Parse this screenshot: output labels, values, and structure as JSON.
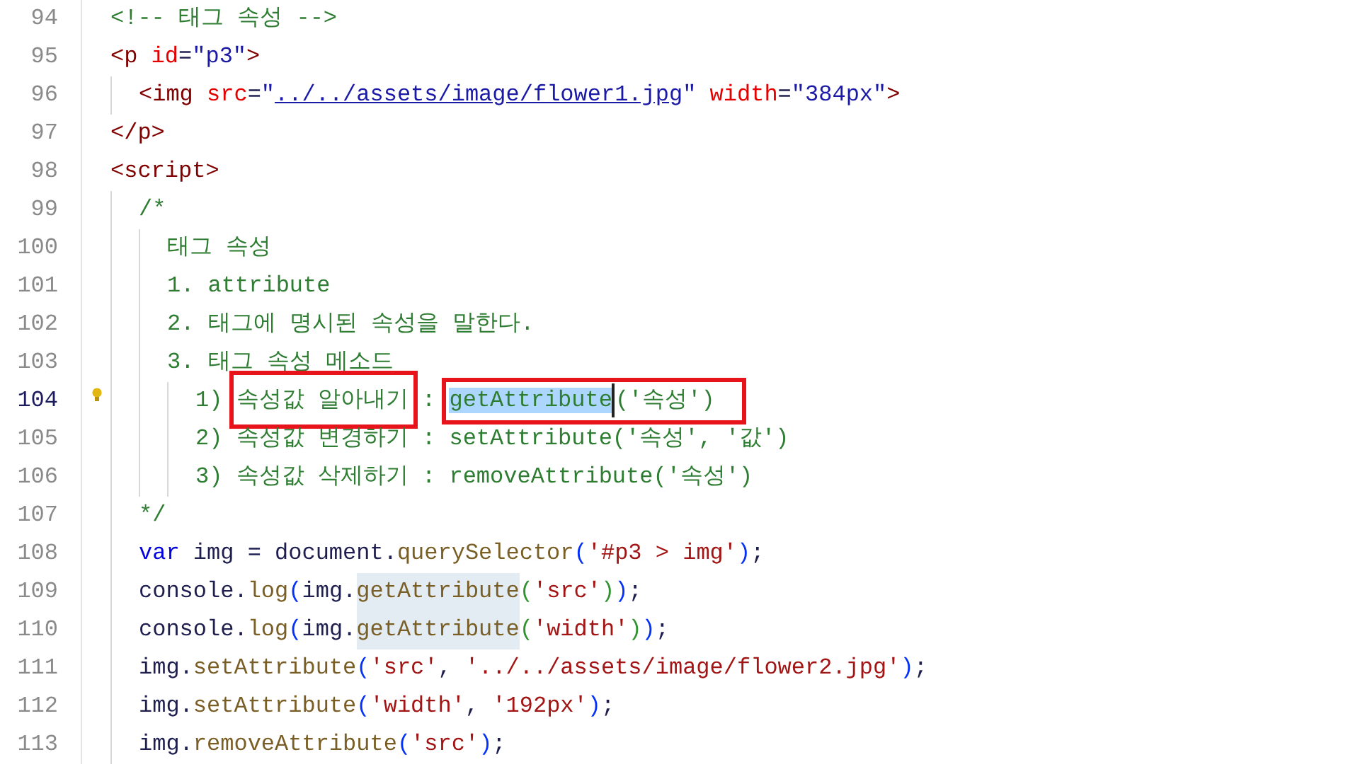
{
  "editor": {
    "lines": [
      {
        "number": "94",
        "tokens": [
          {
            "kind": "comment",
            "text": "<!-- 태그 속성 -->"
          }
        ]
      },
      {
        "number": "95",
        "tokens": [
          {
            "kind": "tag",
            "text": "<p"
          },
          {
            "kind": "attr",
            "text": " id"
          },
          {
            "kind": "plain",
            "text": "="
          },
          {
            "kind": "value",
            "text": "\"p3\""
          },
          {
            "kind": "tag",
            "text": ">"
          }
        ],
        "children": [
          {
            "number": "96",
            "tokens": [
              {
                "kind": "tag",
                "text": "<img"
              },
              {
                "kind": "attr",
                "text": " src"
              },
              {
                "kind": "plain",
                "text": "="
              },
              {
                "kind": "value",
                "text": "\""
              },
              {
                "kind": "link",
                "text": "../../assets/image/flower1.jpg"
              },
              {
                "kind": "value",
                "text": "\""
              },
              {
                "kind": "attr",
                "text": " width"
              },
              {
                "kind": "plain",
                "text": "="
              },
              {
                "kind": "value",
                "text": "\"384px\""
              },
              {
                "kind": "tag",
                "text": ">"
              }
            ]
          }
        ]
      },
      {
        "number": "97",
        "tokens": [
          {
            "kind": "tag",
            "text": "</p>"
          }
        ]
      },
      {
        "number": "98",
        "tokens": [
          {
            "kind": "tag",
            "text": "<script>"
          }
        ],
        "children": [
          {
            "number": "99",
            "tokens": [
              {
                "kind": "comment",
                "text": "/*"
              }
            ],
            "children": [
              {
                "number": "100",
                "tokens": [
                  {
                    "kind": "comment",
                    "text": "태그 속성"
                  }
                ]
              },
              {
                "number": "101",
                "tokens": [
                  {
                    "kind": "comment",
                    "text": "1. attribute"
                  }
                ]
              },
              {
                "number": "102",
                "tokens": [
                  {
                    "kind": "comment",
                    "text": "2. 태그에 명시된 속성을 말한다."
                  }
                ]
              },
              {
                "number": "103",
                "tokens": [
                  {
                    "kind": "comment",
                    "text": "3. 태그 속성 메소드"
                  }
                ],
                "children": [
                  {
                    "number": "104",
                    "current": true,
                    "lightbulb": true,
                    "tokens": [
                      {
                        "kind": "comment",
                        "text": "1) "
                      },
                      {
                        "kind": "box",
                        "tokens": [
                          {
                            "kind": "comment",
                            "text": "속성값 알아내기"
                          }
                        ]
                      },
                      {
                        "kind": "comment",
                        "text": " : "
                      },
                      {
                        "kind": "box",
                        "tokens": [
                          {
                            "kind": "comment",
                            "text": "getAttribute",
                            "selected": true
                          },
                          {
                            "kind": "cursor"
                          },
                          {
                            "kind": "comment",
                            "text": "('속성')"
                          }
                        ]
                      }
                    ]
                  },
                  {
                    "number": "105",
                    "tokens": [
                      {
                        "kind": "comment",
                        "text": "2) 속성값 변경하기 : setAttribute('속성', '값')"
                      }
                    ]
                  },
                  {
                    "number": "106",
                    "tokens": [
                      {
                        "kind": "comment",
                        "text": "3) 속성값 삭제하기 : removeAttribute('속성')"
                      }
                    ]
                  }
                ]
              }
            ]
          },
          {
            "number": "107",
            "tokens": [
              {
                "kind": "comment",
                "text": "*/"
              }
            ]
          },
          {
            "number": "108",
            "tokens": [
              {
                "kind": "keyword",
                "text": "var"
              },
              {
                "kind": "plain",
                "text": " img = document."
              },
              {
                "kind": "method",
                "text": "querySelector"
              },
              {
                "kind": "bracket1",
                "text": "("
              },
              {
                "kind": "string",
                "text": "'#p3 > img'"
              },
              {
                "kind": "bracket1",
                "text": ")"
              },
              {
                "kind": "plain",
                "text": ";"
              }
            ]
          },
          {
            "number": "109",
            "tokens": [
              {
                "kind": "plain",
                "text": "console."
              },
              {
                "kind": "method",
                "text": "log"
              },
              {
                "kind": "bracket1",
                "text": "("
              },
              {
                "kind": "plain",
                "text": "img."
              },
              {
                "kind": "method",
                "text": "getAttribute",
                "highlighted": true
              },
              {
                "kind": "bracket2",
                "text": "("
              },
              {
                "kind": "string",
                "text": "'src'"
              },
              {
                "kind": "bracket2",
                "text": ")"
              },
              {
                "kind": "bracket1",
                "text": ")"
              },
              {
                "kind": "plain",
                "text": ";"
              }
            ]
          },
          {
            "number": "110",
            "tokens": [
              {
                "kind": "plain",
                "text": "console."
              },
              {
                "kind": "method",
                "text": "log"
              },
              {
                "kind": "bracket1",
                "text": "("
              },
              {
                "kind": "plain",
                "text": "img."
              },
              {
                "kind": "method",
                "text": "getAttribute",
                "highlighted": true
              },
              {
                "kind": "bracket2",
                "text": "("
              },
              {
                "kind": "string",
                "text": "'width'"
              },
              {
                "kind": "bracket2",
                "text": ")"
              },
              {
                "kind": "bracket1",
                "text": ")"
              },
              {
                "kind": "plain",
                "text": ";"
              }
            ]
          },
          {
            "number": "111",
            "tokens": [
              {
                "kind": "plain",
                "text": "img."
              },
              {
                "kind": "method",
                "text": "setAttribute"
              },
              {
                "kind": "bracket1",
                "text": "("
              },
              {
                "kind": "string",
                "text": "'src'"
              },
              {
                "kind": "plain",
                "text": ", "
              },
              {
                "kind": "string",
                "text": "'../../assets/image/flower2.jpg'"
              },
              {
                "kind": "bracket1",
                "text": ")"
              },
              {
                "kind": "plain",
                "text": ";"
              }
            ]
          },
          {
            "number": "112",
            "tokens": [
              {
                "kind": "plain",
                "text": "img."
              },
              {
                "kind": "method",
                "text": "setAttribute"
              },
              {
                "kind": "bracket1",
                "text": "("
              },
              {
                "kind": "string",
                "text": "'width'"
              },
              {
                "kind": "plain",
                "text": ", "
              },
              {
                "kind": "string",
                "text": "'192px'"
              },
              {
                "kind": "bracket1",
                "text": ")"
              },
              {
                "kind": "plain",
                "text": ";"
              }
            ]
          },
          {
            "number": "113",
            "tokens": [
              {
                "kind": "plain",
                "text": "img."
              },
              {
                "kind": "method",
                "text": "removeAttribute"
              },
              {
                "kind": "bracket1",
                "text": "("
              },
              {
                "kind": "string",
                "text": "'src'"
              },
              {
                "kind": "bracket1",
                "text": ")"
              },
              {
                "kind": "plain",
                "text": ";"
              }
            ]
          }
        ]
      }
    ]
  }
}
